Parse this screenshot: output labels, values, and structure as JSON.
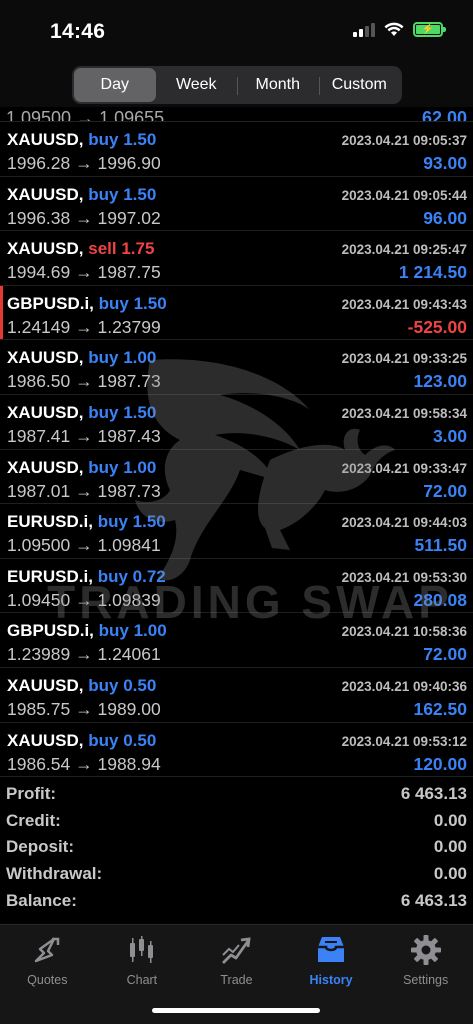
{
  "status": {
    "time": "14:46",
    "battery": "⚡"
  },
  "segments": [
    {
      "label": "Day",
      "active": true
    },
    {
      "label": "Week",
      "active": false
    },
    {
      "label": "Month",
      "active": false
    },
    {
      "label": "Custom",
      "active": false
    }
  ],
  "partial": {
    "prices": "1.09500 → 1.09655",
    "profit": "62.00"
  },
  "deals": [
    {
      "symbol": "XAUUSD,",
      "side": "buy 1.50",
      "type": "buy",
      "time": "2023.04.21 09:05:37",
      "prices": "1996.28 → 1996.90",
      "profit": "93.00",
      "neg": false
    },
    {
      "symbol": "XAUUSD,",
      "side": "buy 1.50",
      "type": "buy",
      "time": "2023.04.21 09:05:44",
      "prices": "1996.38 → 1997.02",
      "profit": "96.00",
      "neg": false
    },
    {
      "symbol": "XAUUSD,",
      "side": "sell 1.75",
      "type": "sell",
      "time": "2023.04.21 09:25:47",
      "prices": "1994.69 → 1987.75",
      "profit": "1 214.50",
      "neg": false
    },
    {
      "symbol": "GBPUSD.i,",
      "side": "buy 1.50",
      "type": "buy",
      "time": "2023.04.21 09:43:43",
      "prices": "1.24149 → 1.23799",
      "profit": "-525.00",
      "neg": true
    },
    {
      "symbol": "XAUUSD,",
      "side": "buy 1.00",
      "type": "buy",
      "time": "2023.04.21 09:33:25",
      "prices": "1986.50 → 1987.73",
      "profit": "123.00",
      "neg": false
    },
    {
      "symbol": "XAUUSD,",
      "side": "buy 1.50",
      "type": "buy",
      "time": "2023.04.21 09:58:34",
      "prices": "1987.41 → 1987.43",
      "profit": "3.00",
      "neg": false
    },
    {
      "symbol": "XAUUSD,",
      "side": "buy 1.00",
      "type": "buy",
      "time": "2023.04.21 09:33:47",
      "prices": "1987.01 → 1987.73",
      "profit": "72.00",
      "neg": false
    },
    {
      "symbol": "EURUSD.i,",
      "side": "buy 1.50",
      "type": "buy",
      "time": "2023.04.21 09:44:03",
      "prices": "1.09500 → 1.09841",
      "profit": "511.50",
      "neg": false
    },
    {
      "symbol": "EURUSD.i,",
      "side": "buy 0.72",
      "type": "buy",
      "time": "2023.04.21 09:53:30",
      "prices": "1.09450 → 1.09839",
      "profit": "280.08",
      "neg": false
    },
    {
      "symbol": "GBPUSD.i,",
      "side": "buy 1.00",
      "type": "buy",
      "time": "2023.04.21 10:58:36",
      "prices": "1.23989 → 1.24061",
      "profit": "72.00",
      "neg": false
    },
    {
      "symbol": "XAUUSD,",
      "side": "buy 0.50",
      "type": "buy",
      "time": "2023.04.21 09:40:36",
      "prices": "1985.75 → 1989.00",
      "profit": "162.50",
      "neg": false
    },
    {
      "symbol": "XAUUSD,",
      "side": "buy 0.50",
      "type": "buy",
      "time": "2023.04.21 09:53:12",
      "prices": "1986.54 → 1988.94",
      "profit": "120.00",
      "neg": false
    }
  ],
  "summary": [
    {
      "label": "Profit:",
      "value": "6 463.13"
    },
    {
      "label": "Credit:",
      "value": "0.00"
    },
    {
      "label": "Deposit:",
      "value": "0.00"
    },
    {
      "label": "Withdrawal:",
      "value": "0.00"
    },
    {
      "label": "Balance:",
      "value": "6 463.13"
    }
  ],
  "watermark": {
    "text": "TRADING SWAP"
  },
  "tabs": [
    {
      "label": "Quotes",
      "icon": "quotes-icon",
      "active": false
    },
    {
      "label": "Chart",
      "icon": "chart-icon",
      "active": false
    },
    {
      "label": "Trade",
      "icon": "trade-icon",
      "active": false
    },
    {
      "label": "History",
      "icon": "history-icon",
      "active": true
    },
    {
      "label": "Settings",
      "icon": "gear-icon",
      "active": false
    }
  ],
  "colors": {
    "buy": "#3a82f6",
    "sell": "#ef4444",
    "accent": "#3a82f6"
  }
}
